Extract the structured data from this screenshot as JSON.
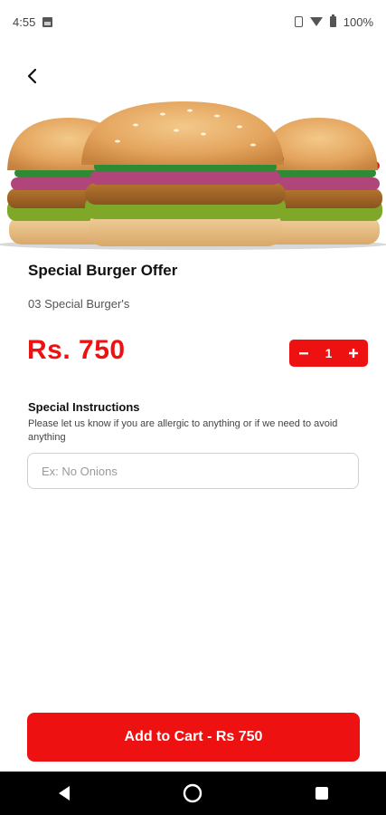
{
  "status_bar": {
    "time": "4:55",
    "battery": "100%",
    "icons": [
      "image-icon",
      "vibrate-icon",
      "wifi-icon",
      "battery-icon"
    ]
  },
  "header": {
    "back_icon": "chevron-left-icon"
  },
  "product": {
    "image_alt": "three burgers",
    "title": "Special Burger Offer",
    "description": "03 Special Burger's",
    "price": "Rs. 750",
    "quantity": "1",
    "decrement_icon": "minus-icon",
    "increment_icon": "plus-icon"
  },
  "instructions": {
    "label": "Special Instructions",
    "help": "Please let us know if you are allergic to anything or if we need to avoid anything",
    "placeholder": "Ex: No Onions",
    "value": ""
  },
  "cta": {
    "label": "Add to Cart - Rs 750"
  },
  "nav": {
    "icons": [
      "back-triangle-icon",
      "home-circle-icon",
      "recents-square-icon"
    ]
  },
  "colors": {
    "accent": "#ee1111",
    "nav_background": "#000000"
  }
}
